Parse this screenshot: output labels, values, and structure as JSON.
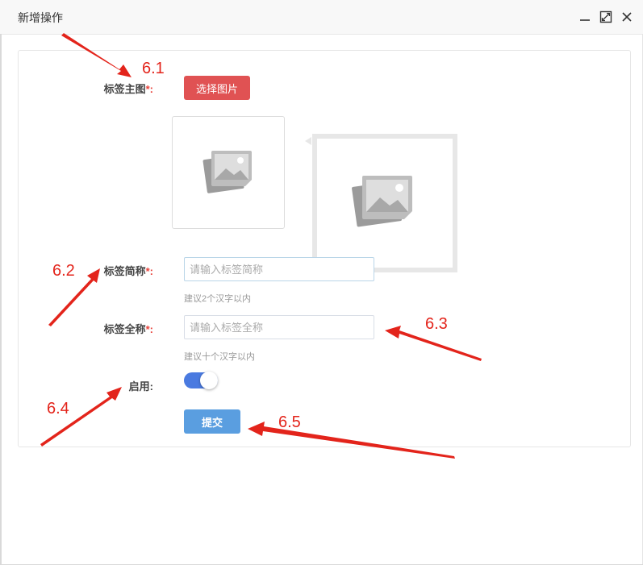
{
  "window": {
    "title": "新增操作",
    "controls": [
      "minimize-icon",
      "maximize-icon",
      "close-icon"
    ]
  },
  "form": {
    "image_field": {
      "label": "标签主图",
      "required_mark": "*:",
      "button_label": "选择图片"
    },
    "short_name": {
      "label": "标签简称",
      "required_mark": "*:",
      "placeholder": "请输入标签简称",
      "value": "",
      "hint": "建议2个汉字以内"
    },
    "full_name": {
      "label": "标签全称",
      "required_mark": "*:",
      "placeholder": "请输入标签全称",
      "value": "",
      "hint": "建议十个汉字以内"
    },
    "enabled": {
      "label": "启用:",
      "on": true
    },
    "submit_label": "提交"
  },
  "annotations": [
    "6.1",
    "6.2",
    "6.3",
    "6.4",
    "6.5"
  ],
  "colors": {
    "primary_red": "#e05253",
    "required_star": "#e8423b",
    "toggle_on": "#4a7ae0",
    "submit_blue": "#5a9ee0",
    "annotation_red": "#e3241b"
  }
}
